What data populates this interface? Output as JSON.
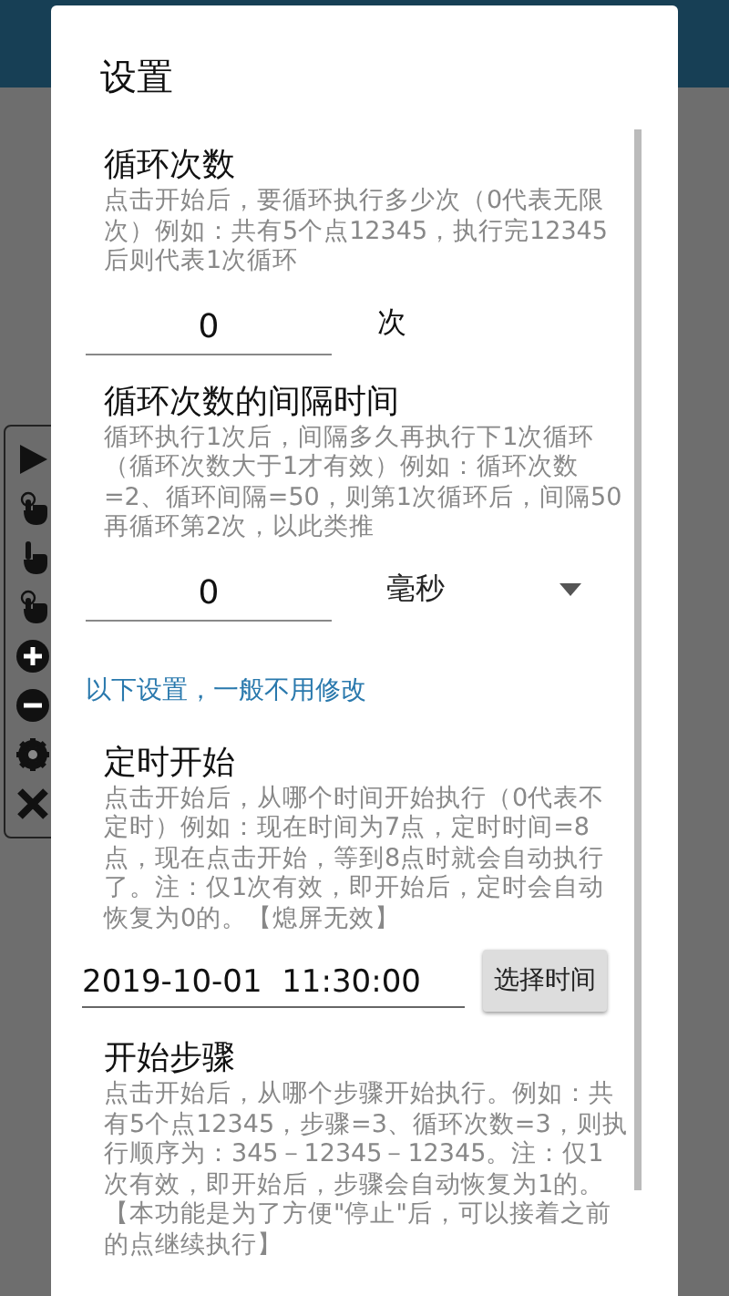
{
  "toolbar": [
    {
      "kind": "play"
    },
    {
      "kind": "tap"
    },
    {
      "kind": "swipe"
    },
    {
      "kind": "tap"
    },
    {
      "kind": "plus"
    },
    {
      "kind": "minus"
    },
    {
      "kind": "gear"
    },
    {
      "kind": "close"
    }
  ],
  "dialog": {
    "title": "设置",
    "sections": [
      {
        "kind": "field",
        "title": "循环次数",
        "description": "点击开始后，要循环执行多少次（0代表无限次）例如：共有5个点12345，执行完12345后则代表1次循环",
        "value": "0",
        "unit": "次"
      },
      {
        "kind": "select",
        "title": "循环次数的间隔时间",
        "description": "循环执行1次后，间隔多久再执行下1次循环（循环次数大于1才有效）例如：循环次数=2、循环间隔=50，则第1次循环后，间隔50再循环第2次，以此类推",
        "value": "0",
        "unit": "毫秒"
      },
      {
        "kind": "note",
        "text": "以下设置，一般不用修改"
      },
      {
        "kind": "time",
        "title": "定时开始",
        "description": "点击开始后，从哪个时间开始执行（0代表不定时）例如：现在时间为7点，定时时间=8点，现在点击开始，等到8点时就会自动执行了。注：仅1次有效，即开始后，定时会自动恢复为0的。【熄屏无效】",
        "value": "2019-10-01  11:30:00",
        "button": "选择时间"
      },
      {
        "kind": "text",
        "title": "开始步骤",
        "description": "点击开始后，从哪个步骤开始执行。例如：共有5个点12345，步骤=3、循环次数=3，则执行顺序为：345－12345－12345。注：仅1次有效，即开始后，步骤会自动恢复为1的。【本功能是为了方便\"停止\"后，可以接着之前的点继续执行】"
      }
    ]
  }
}
